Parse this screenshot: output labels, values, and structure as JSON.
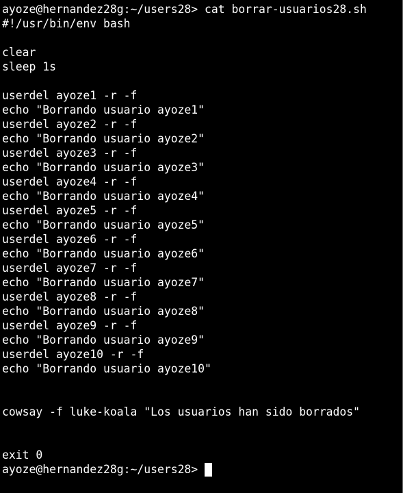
{
  "terminal": {
    "first_prompt": "ayoze@hernandez28g:~/users28> ",
    "command": "cat borrar-usuarios28.sh",
    "lines": [
      "#!/usr/bin/env bash",
      "",
      "clear",
      "sleep 1s",
      "",
      "userdel ayoze1 -r -f",
      "echo \"Borrando usuario ayoze1\"",
      "userdel ayoze2 -r -f",
      "echo \"Borrando usuario ayoze2\"",
      "userdel ayoze3 -r -f",
      "echo \"Borrando usuario ayoze3\"",
      "userdel ayoze4 -r -f",
      "echo \"Borrando usuario ayoze4\"",
      "userdel ayoze5 -r -f",
      "echo \"Borrando usuario ayoze5\"",
      "userdel ayoze6 -r -f",
      "echo \"Borrando usuario ayoze6\"",
      "userdel ayoze7 -r -f",
      "echo \"Borrando usuario ayoze7\"",
      "userdel ayoze8 -r -f",
      "echo \"Borrando usuario ayoze8\"",
      "userdel ayoze9 -r -f",
      "echo \"Borrando usuario ayoze9\"",
      "userdel ayoze10 -r -f",
      "echo \"Borrando usuario ayoze10\"",
      "",
      "",
      "cowsay -f luke-koala \"Los usuarios han sido borrados\"",
      "",
      "",
      "exit 0"
    ],
    "final_prompt": "ayoze@hernandez28g:~/users28> "
  },
  "colors": {
    "background": "#000000",
    "foreground": "#ffffff"
  }
}
